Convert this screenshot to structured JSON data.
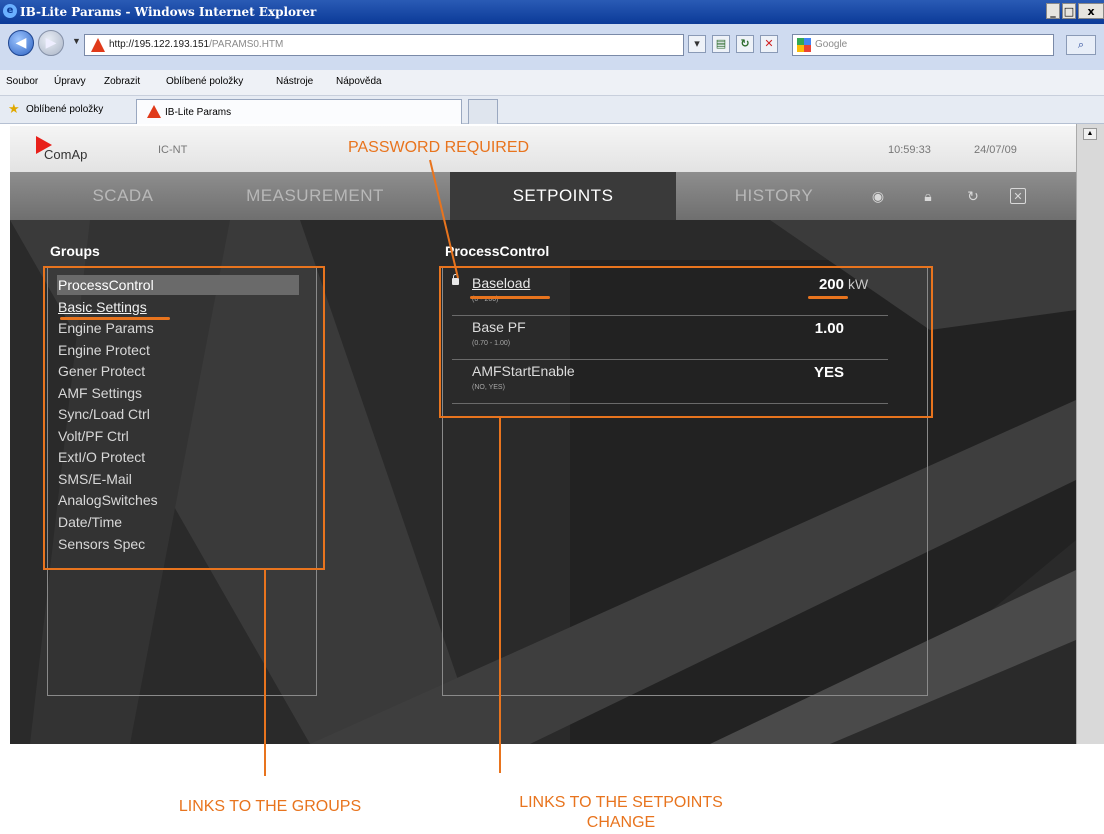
{
  "browser": {
    "title": "IB-Lite Params - Windows Internet Explorer",
    "window_controls": [
      "_",
      "□",
      "x"
    ],
    "address_host": "http://195.122.193.151",
    "address_path": "/PARAMS0.HTM",
    "search_placeholder": "Google",
    "menu": [
      "Soubor",
      "Úpravy",
      "Zobrazit",
      "Oblíbené položky",
      "Nástroje",
      "Nápověda"
    ],
    "favorites_label": "Oblíbené položky",
    "tab_label": "IB-Lite Params"
  },
  "app": {
    "logo_text": "ComAp",
    "controller_model": "IC-NT",
    "time": "10:59:33",
    "date": "24/07/09",
    "nav_tabs": [
      "SCADA",
      "MEASUREMENT",
      "SETPOINTS",
      "HISTORY"
    ],
    "active_tab": "SETPOINTS",
    "nav_icons": [
      "target-icon",
      "lock-icon",
      "refresh-icon",
      "close-icon"
    ],
    "groups": {
      "title": "Groups",
      "items": [
        "ProcessControl",
        "Basic Settings",
        "Engine Params",
        "Engine Protect",
        "Gener Protect",
        "AMF Settings",
        "Sync/Load Ctrl",
        "Volt/PF Ctrl",
        "ExtI/O Protect",
        "SMS/E-Mail",
        "AnalogSwitches",
        "Date/Time",
        "Sensors Spec"
      ],
      "selected": "ProcessControl"
    },
    "setpoints": {
      "title": "ProcessControl",
      "rows": [
        {
          "name": "Baseload",
          "range": "(0 - 200)",
          "value": "200",
          "unit": "kW",
          "password_protected": true
        },
        {
          "name": "Base PF",
          "range": "(0.70 - 1.00)",
          "value": "1.00",
          "unit": "",
          "password_protected": false
        },
        {
          "name": "AMFStartEnable",
          "range": "(NO, YES)",
          "value": "YES",
          "unit": "",
          "password_protected": false
        }
      ]
    }
  },
  "annotations": {
    "password_required": "PASSWORD REQUIRED",
    "links_groups": "LINKS TO THE GROUPS",
    "links_setpoints_line1": "LINKS TO THE SETPOINTS",
    "links_setpoints_line2": "CHANGE",
    "color": "#e8741e"
  }
}
